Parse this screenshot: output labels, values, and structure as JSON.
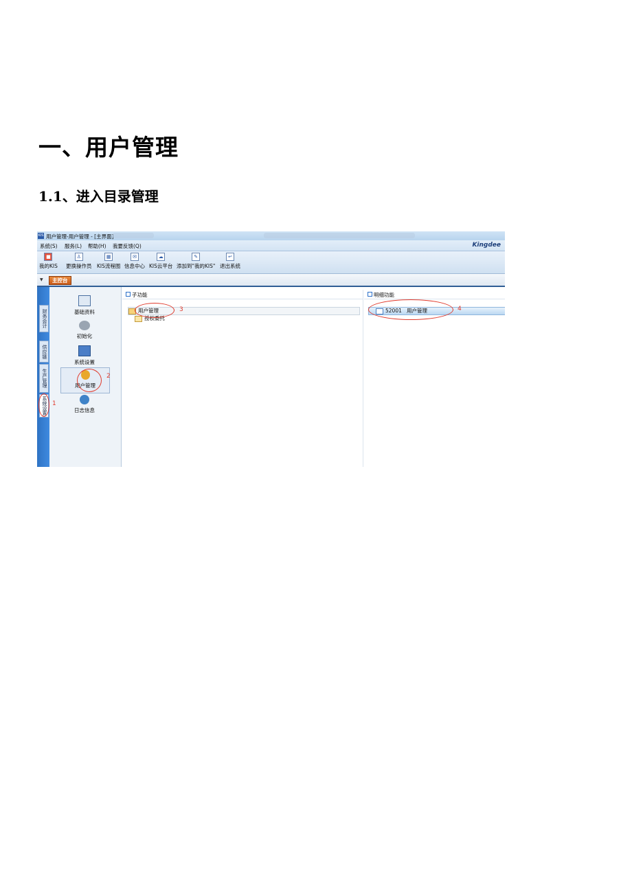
{
  "heading1": "一、用户管理",
  "heading2": "1.1、进入目录管理",
  "screenshot": {
    "window_title": "用户管理-用户管理 - [主界面]",
    "app_icon": "KIS",
    "menu": [
      "系统(S)",
      "服务(L)",
      "帮助(H)",
      "我要反馈(Q)"
    ],
    "logo": "Kingdee",
    "toolbar": [
      "我的KIS",
      "更换操作员",
      "KIS流程图",
      "信息中心",
      "KIS云平台",
      "添加到\"我的KIS\"",
      "退出系统"
    ],
    "main_tab": "主控台",
    "side_tabs": [
      "财务会计",
      "供应链",
      "生产管理",
      "系统设置"
    ],
    "nav_items": [
      "基础资料",
      "初始化",
      "系统设置",
      "用户管理",
      "日志信息"
    ],
    "sub_header": "子功能",
    "sub_items": [
      "用户管理",
      "授权委托"
    ],
    "detail_header": "明细功能",
    "detail_code": "52001",
    "detail_name": "用户管理",
    "annotations": [
      "1",
      "2",
      "3",
      "4"
    ],
    "colors": {
      "accent": "#2f73c4",
      "annotation": "#e0392b",
      "tab": "#c95a18"
    }
  }
}
